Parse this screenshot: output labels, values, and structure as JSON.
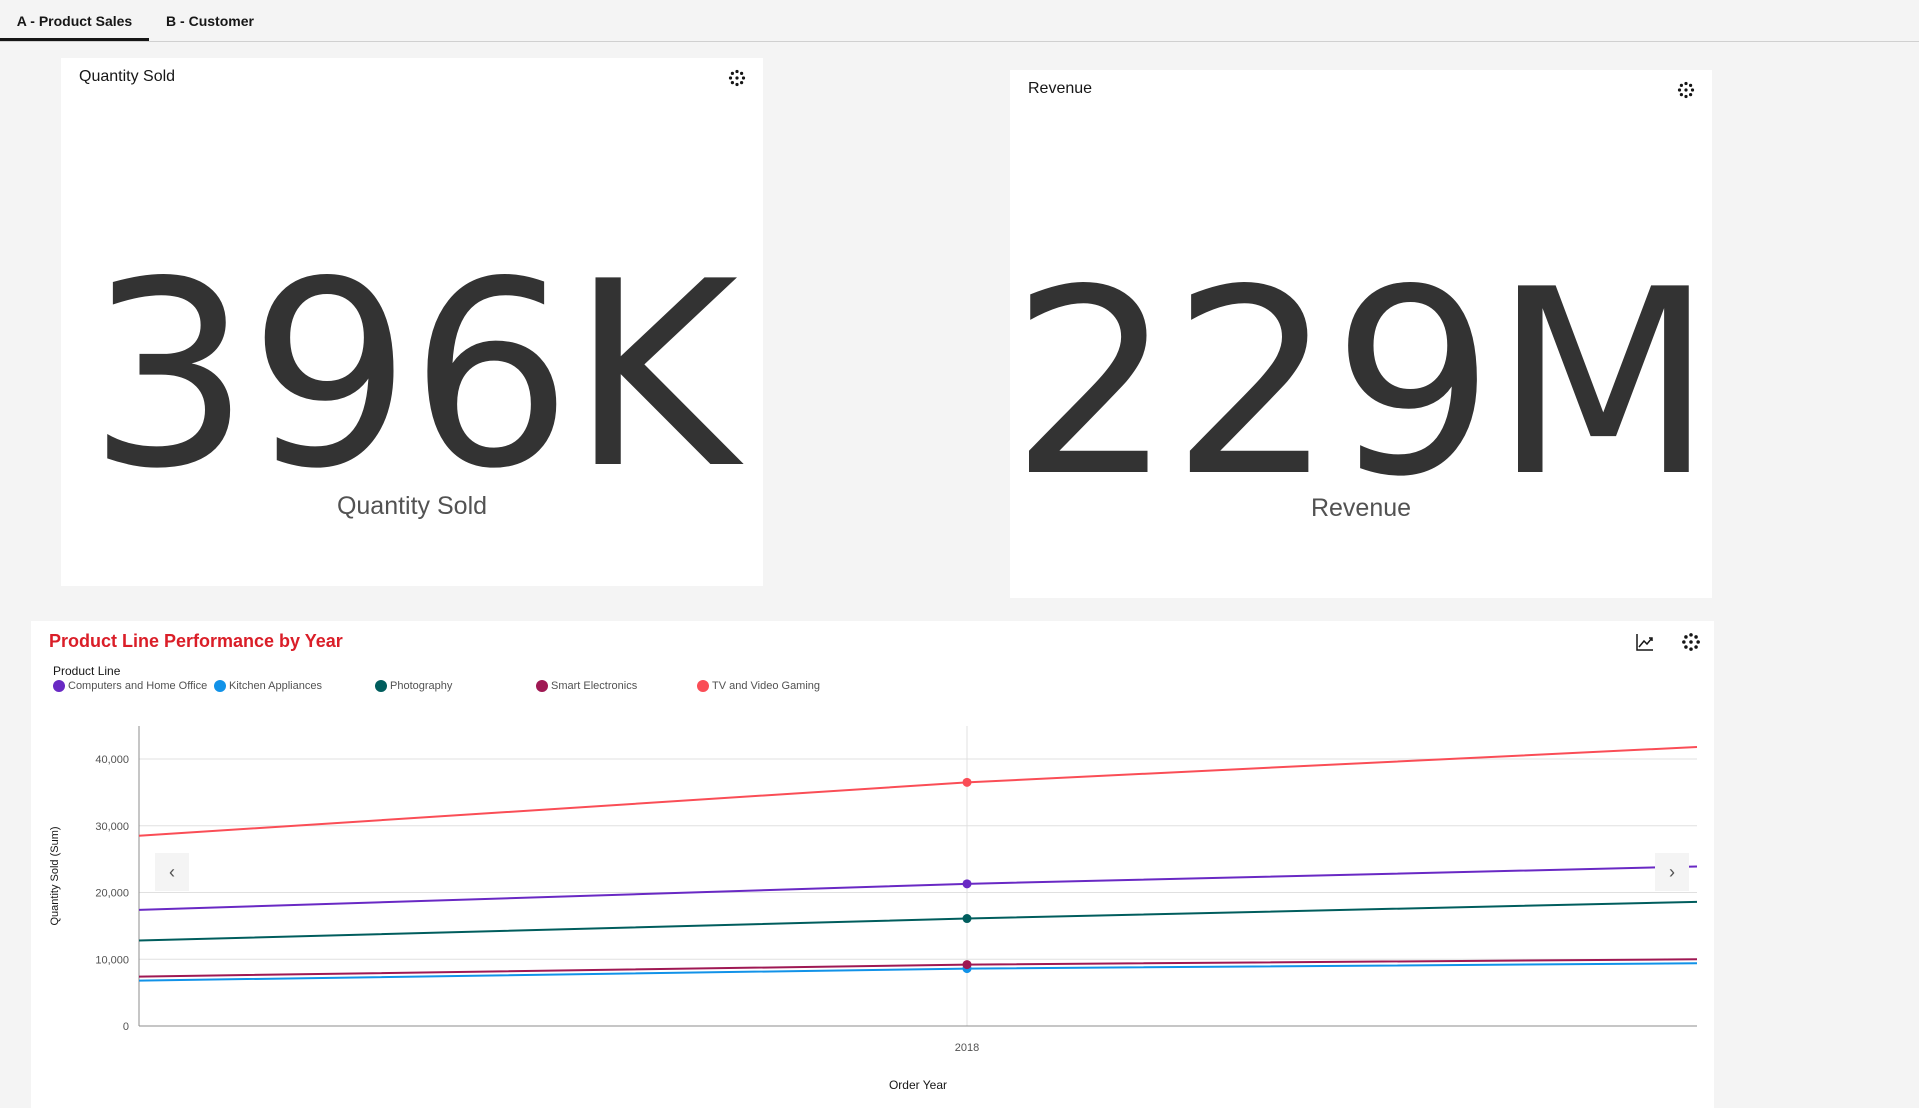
{
  "tabs": [
    {
      "label": "A - Product Sales",
      "active": true
    },
    {
      "label": "B - Customer",
      "active": false
    }
  ],
  "kpi_quantity": {
    "title": "Quantity Sold",
    "value": "396K",
    "label": "Quantity Sold",
    "icon": "settings-icon"
  },
  "kpi_revenue": {
    "title": "Revenue",
    "value": "229M",
    "label": "Revenue",
    "icon": "settings-icon"
  },
  "line_chart": {
    "title": "Product Line Performance by Year",
    "legend_title": "Product Line",
    "icons": [
      "line-chart-icon",
      "settings-icon"
    ],
    "nav": {
      "prev": "‹",
      "next": "›"
    }
  },
  "chart_data": {
    "type": "line",
    "title": "Product Line Performance by Year",
    "xlabel": "Order Year",
    "ylabel": "Quantity Sold (Sum)",
    "x_ticks": [
      "2018"
    ],
    "y_ticks": [
      "0",
      "10,000",
      "20,000",
      "30,000",
      "40,000"
    ],
    "ylim": [
      0,
      40000
    ],
    "grid": true,
    "legend_position": "top-left",
    "series": [
      {
        "name": "Computers and Home Office",
        "color": "#6929c4",
        "points": [
          {
            "x": "2018",
            "y": 21300
          }
        ],
        "start_y": 17400,
        "end_y": 23900
      },
      {
        "name": "Kitchen Appliances",
        "color": "#1192e8",
        "points": [
          {
            "x": "2018",
            "y": 8600
          }
        ],
        "start_y": 6800,
        "end_y": 9400
      },
      {
        "name": "Photography",
        "color": "#005d5d",
        "points": [
          {
            "x": "2018",
            "y": 16100
          }
        ],
        "start_y": 12800,
        "end_y": 18600
      },
      {
        "name": "Smart Electronics",
        "color": "#9f1853",
        "points": [
          {
            "x": "2018",
            "y": 9200
          }
        ],
        "start_y": 7400,
        "end_y": 10000
      },
      {
        "name": "TV and Video Gaming",
        "color": "#fa4d56",
        "points": [
          {
            "x": "2018",
            "y": 36500
          }
        ],
        "start_y": 28500,
        "end_y": 41800
      }
    ]
  }
}
